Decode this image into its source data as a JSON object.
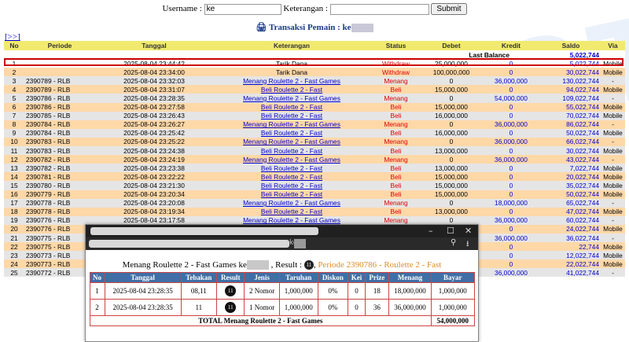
{
  "search": {
    "username_label": "Username :",
    "username_value": "ke",
    "keterangan_label": "Keterangan :",
    "keterangan_value": "",
    "submit_label": "Submit"
  },
  "title": {
    "icon": "printer-icon",
    "text": "Transaksi Pemain : ke"
  },
  "expand_label": "[>>]",
  "table": {
    "headers": [
      "No",
      "Periode",
      "Tanggal",
      "Keterangan",
      "Status",
      "Debet",
      "Kredit",
      "Saldo",
      "Via"
    ],
    "last_balance_label": "Last Balance",
    "last_balance_value": "5,022,744",
    "rows": [
      {
        "no": "1",
        "periode": "",
        "tanggal": "2025-08-04 23:44:42",
        "ket": "Tarik Dana",
        "link": false,
        "status": "Withdraw",
        "debet": "25,000,000",
        "kredit": "0",
        "saldo": "5,022,744",
        "via": "Mobile"
      },
      {
        "no": "2",
        "periode": "",
        "tanggal": "2025-08-04 23:34:00",
        "ket": "Tarik Dana",
        "link": false,
        "status": "Withdraw",
        "debet": "100,000,000",
        "kredit": "0",
        "saldo": "30,022,744",
        "via": "Mobile"
      },
      {
        "no": "3",
        "periode": "2390789 - RLB",
        "tanggal": "2025-08-04 23:32:03",
        "ket": "Menang Roulette 2 - Fast Games",
        "link": true,
        "status": "Menang",
        "debet": "0",
        "kredit": "36,000,000",
        "saldo": "130,022,744",
        "via": "-"
      },
      {
        "no": "4",
        "periode": "2390789 - RLB",
        "tanggal": "2025-08-04 23:31:07",
        "ket": "Beli Roulette 2 - Fast",
        "link": true,
        "status": "Beli",
        "debet": "15,000,000",
        "kredit": "0",
        "saldo": "94,022,744",
        "via": "Mobile"
      },
      {
        "no": "5",
        "periode": "2390786 - RLB",
        "tanggal": "2025-08-04 23:28:35",
        "ket": "Menang Roulette 2 - Fast Games",
        "link": true,
        "status": "Menang",
        "debet": "0",
        "kredit": "54,000,000",
        "saldo": "109,022,744",
        "via": "-"
      },
      {
        "no": "6",
        "periode": "2390786 - RLB",
        "tanggal": "2025-08-04 23:27:58",
        "ket": "Beli Roulette 2 - Fast",
        "link": true,
        "status": "Beli",
        "debet": "15,000,000",
        "kredit": "0",
        "saldo": "55,022,744",
        "via": "Mobile"
      },
      {
        "no": "7",
        "periode": "2390785 - RLB",
        "tanggal": "2025-08-04 23:26:43",
        "ket": "Beli Roulette 2 - Fast",
        "link": true,
        "status": "Beli",
        "debet": "16,000,000",
        "kredit": "0",
        "saldo": "70,022,744",
        "via": "Mobile"
      },
      {
        "no": "8",
        "periode": "2390784 - RLB",
        "tanggal": "2025-08-04 23:26:27",
        "ket": "Menang Roulette 2 - Fast Games",
        "link": true,
        "status": "Menang",
        "debet": "0",
        "kredit": "36,000,000",
        "saldo": "86,022,744",
        "via": "-"
      },
      {
        "no": "9",
        "periode": "2390784 - RLB",
        "tanggal": "2025-08-04 23:25:42",
        "ket": "Beli Roulette 2 - Fast",
        "link": true,
        "status": "Beli",
        "debet": "16,000,000",
        "kredit": "0",
        "saldo": "50,022,744",
        "via": "Mobile"
      },
      {
        "no": "10",
        "periode": "2390783 - RLB",
        "tanggal": "2025-08-04 23:25:22",
        "ket": "Menang Roulette 2 - Fast Games",
        "link": true,
        "status": "Menang",
        "debet": "0",
        "kredit": "36,000,000",
        "saldo": "66,022,744",
        "via": "-"
      },
      {
        "no": "11",
        "periode": "2390783 - RLB",
        "tanggal": "2025-08-04 23:24:38",
        "ket": "Beli Roulette 2 - Fast",
        "link": true,
        "status": "Beli",
        "debet": "13,000,000",
        "kredit": "0",
        "saldo": "30,022,744",
        "via": "Mobile"
      },
      {
        "no": "12",
        "periode": "2390782 - RLB",
        "tanggal": "2025-08-04 23:24:19",
        "ket": "Menang Roulette 2 - Fast Games",
        "link": true,
        "status": "Menang",
        "debet": "0",
        "kredit": "36,000,000",
        "saldo": "43,022,744",
        "via": "-"
      },
      {
        "no": "13",
        "periode": "2390782 - RLB",
        "tanggal": "2025-08-04 23:23:38",
        "ket": "Beli Roulette 2 - Fast",
        "link": true,
        "status": "Beli",
        "debet": "13,000,000",
        "kredit": "0",
        "saldo": "7,022,744",
        "via": "Mobile"
      },
      {
        "no": "14",
        "periode": "2390781 - RLB",
        "tanggal": "2025-08-04 23:22:22",
        "ket": "Beli Roulette 2 - Fast",
        "link": true,
        "status": "Beli",
        "debet": "15,000,000",
        "kredit": "0",
        "saldo": "20,022,744",
        "via": "Mobile"
      },
      {
        "no": "15",
        "periode": "2390780 - RLB",
        "tanggal": "2025-08-04 23:21:30",
        "ket": "Beli Roulette 2 - Fast",
        "link": true,
        "status": "Beli",
        "debet": "15,000,000",
        "kredit": "0",
        "saldo": "35,022,744",
        "via": "Mobile"
      },
      {
        "no": "16",
        "periode": "2390779 - RLB",
        "tanggal": "2025-08-04 23:20:34",
        "ket": "Beli Roulette 2 - Fast",
        "link": true,
        "status": "Beli",
        "debet": "15,000,000",
        "kredit": "0",
        "saldo": "50,022,744",
        "via": "Mobile"
      },
      {
        "no": "17",
        "periode": "2390778 - RLB",
        "tanggal": "2025-08-04 23:20:08",
        "ket": "Menang Roulette 2 - Fast Games",
        "link": true,
        "status": "Menang",
        "debet": "0",
        "kredit": "18,000,000",
        "saldo": "65,022,744",
        "via": "-"
      },
      {
        "no": "18",
        "periode": "2390778 - RLB",
        "tanggal": "2025-08-04 23:19:34",
        "ket": "Beli Roulette 2 - Fast",
        "link": true,
        "status": "Beli",
        "debet": "13,000,000",
        "kredit": "0",
        "saldo": "47,022,744",
        "via": "Mobile"
      },
      {
        "no": "19",
        "periode": "2390776 - RLB",
        "tanggal": "2025-08-04 23:17:58",
        "ket": "Menang Roulette 2 - Fast Games",
        "link": true,
        "status": "Menang",
        "debet": "0",
        "kredit": "36,000,000",
        "saldo": "60,022,744",
        "via": "-"
      },
      {
        "no": "20",
        "periode": "2390776 - RLB",
        "tanggal": "",
        "ket": "",
        "link": true,
        "status": "",
        "debet": "",
        "kredit": "0",
        "saldo": "24,022,744",
        "via": "Mobile"
      },
      {
        "no": "21",
        "periode": "2390775 - RLB",
        "tanggal": "",
        "ket": "",
        "link": true,
        "status": "",
        "debet": "",
        "kredit": "36,000,000",
        "saldo": "36,022,744",
        "via": "-"
      },
      {
        "no": "22",
        "periode": "2390775 - RLB",
        "tanggal": "",
        "ket": "",
        "link": true,
        "status": "",
        "debet": "",
        "kredit": "0",
        "saldo": "22,744",
        "via": "Mobile"
      },
      {
        "no": "23",
        "periode": "2390773 - RLB",
        "tanggal": "",
        "ket": "",
        "link": true,
        "status": "",
        "debet": "",
        "kredit": "0",
        "saldo": "12,022,744",
        "via": "Mobile"
      },
      {
        "no": "24",
        "periode": "2390773 - RLB",
        "tanggal": "",
        "ket": "",
        "link": true,
        "status": "",
        "debet": "",
        "kredit": "0",
        "saldo": "22,022,744",
        "via": "Mobile"
      },
      {
        "no": "25",
        "periode": "2390772 - RLB",
        "tanggal": "",
        "ket": "",
        "link": true,
        "status": "",
        "debet": "",
        "kredit": "36,000,000",
        "saldo": "41,022,744",
        "via": "-"
      }
    ]
  },
  "popup": {
    "url_prefix": "ke",
    "title_prefix": "Menang Roulette 2 - Fast Games ke",
    "result_label": ", Result :",
    "periode_text": "Periode 2390786 - Roulette 2 - Fast",
    "headers": [
      "No",
      "Tanggal",
      "Tebakan",
      "Result",
      "Jenis",
      "Taruhan",
      "Diskon",
      "Kei",
      "Prize",
      "Menang",
      "Bayar"
    ],
    "rows": [
      {
        "no": "1",
        "tanggal": "2025-08-04 23:28:35",
        "tebakan": "08,11",
        "jenis": "2 Nomor",
        "taruhan": "1,000,000",
        "diskon": "0%",
        "kei": "0",
        "prize": "18",
        "menang": "18,000,000",
        "bayar": "1,000,000"
      },
      {
        "no": "2",
        "tanggal": "2025-08-04 23:28:35",
        "tebakan": "11",
        "jenis": "1 Nomor",
        "taruhan": "1,000,000",
        "diskon": "0%",
        "kei": "0",
        "prize": "36",
        "menang": "36,000,000",
        "bayar": "1,000,000"
      }
    ],
    "total_label": "TOTAL Menang Roulette 2 - Fast Games",
    "total_value": "54,000,000",
    "result_ball": "11"
  },
  "watermark": "WONSTOTO"
}
